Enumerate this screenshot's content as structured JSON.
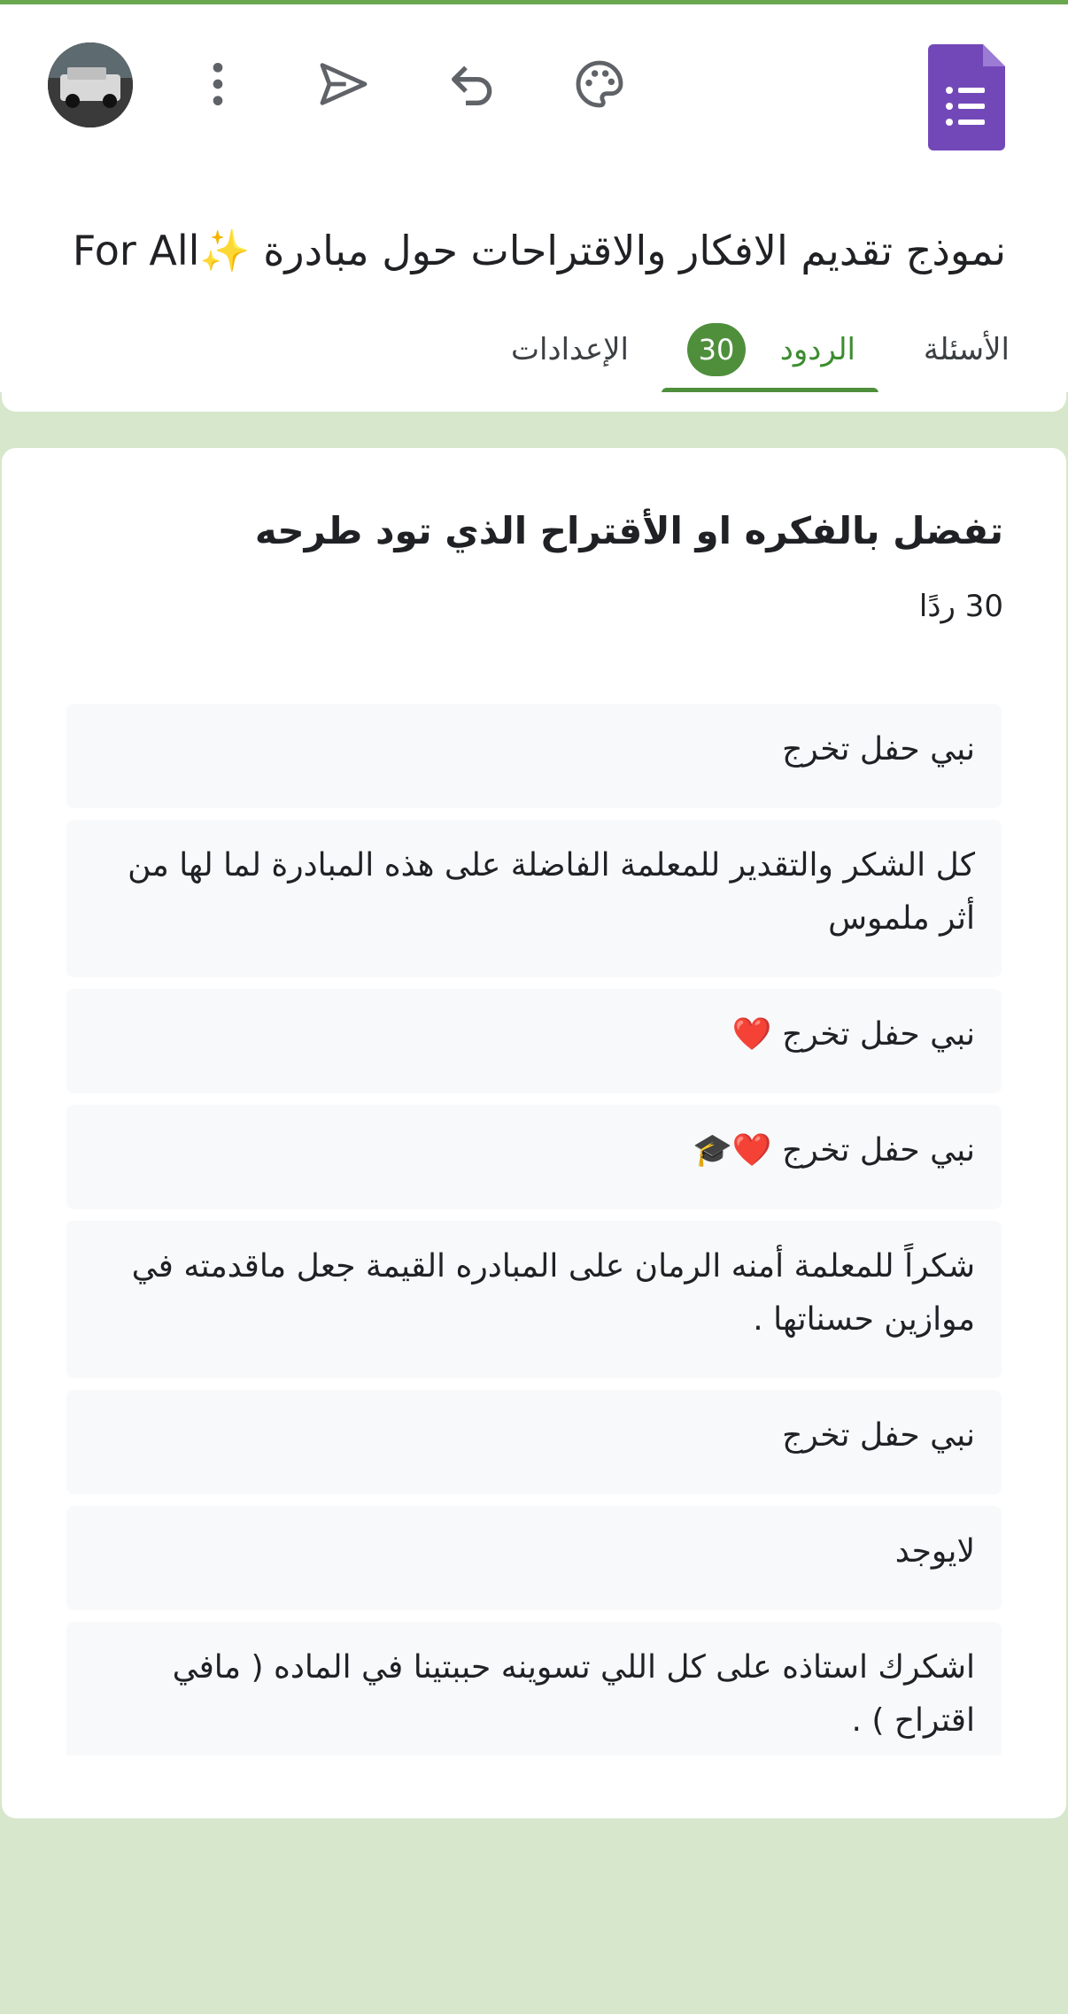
{
  "header": {
    "form_title": "نموذج تقديم الافكار والاقتراحات حول مبادرة ✨For All ",
    "tabs": {
      "questions": "الأسئلة",
      "responses": "الردود",
      "responses_count": "30",
      "settings": "الإعدادات"
    },
    "icons": [
      "more-vert-icon",
      "send-icon",
      "undo-icon",
      "palette-icon",
      "google-forms-logo"
    ]
  },
  "question": {
    "title": "تفضل بالفكره او الأقتراح الذي تود طرحه",
    "count": "30 ردًا"
  },
  "responses": [
    "نبي حفل تخرج",
    "كل الشكر والتقدير للمعلمة الفاضلة على هذه المبادرة لما لها من أثر ملموس",
    "نبي حفل تخرج ❤️",
    "نبي حفل تخرج ❤️🎓",
    "شكراً للمعلمة أمنه الرمان على المبادره القيمة جعل ماقدمته في موازين حسناتها .",
    "نبي حفل تخرج",
    "لايوجد",
    "اشكرك استاذه على كل اللي تسوينه حببتينا في الماده ( مافي اقتراح ) ."
  ],
  "colors": {
    "accent": "#4f8f3c",
    "background": "#d6e7cc",
    "forms_purple": "#7248b9"
  }
}
